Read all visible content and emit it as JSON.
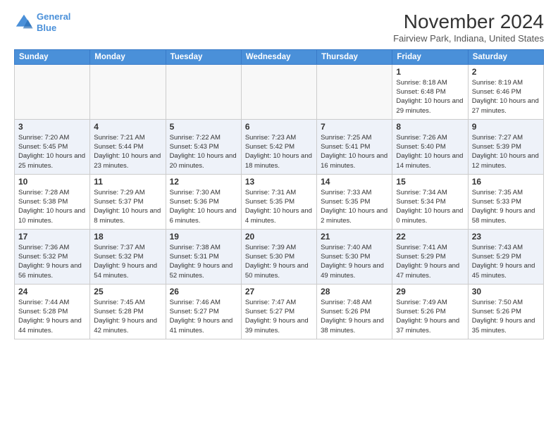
{
  "logo": {
    "line1": "General",
    "line2": "Blue"
  },
  "title": "November 2024",
  "location": "Fairview Park, Indiana, United States",
  "weekdays": [
    "Sunday",
    "Monday",
    "Tuesday",
    "Wednesday",
    "Thursday",
    "Friday",
    "Saturday"
  ],
  "weeks": [
    [
      {
        "day": "",
        "info": ""
      },
      {
        "day": "",
        "info": ""
      },
      {
        "day": "",
        "info": ""
      },
      {
        "day": "",
        "info": ""
      },
      {
        "day": "",
        "info": ""
      },
      {
        "day": "1",
        "info": "Sunrise: 8:18 AM\nSunset: 6:48 PM\nDaylight: 10 hours and 29 minutes."
      },
      {
        "day": "2",
        "info": "Sunrise: 8:19 AM\nSunset: 6:46 PM\nDaylight: 10 hours and 27 minutes."
      }
    ],
    [
      {
        "day": "3",
        "info": "Sunrise: 7:20 AM\nSunset: 5:45 PM\nDaylight: 10 hours and 25 minutes."
      },
      {
        "day": "4",
        "info": "Sunrise: 7:21 AM\nSunset: 5:44 PM\nDaylight: 10 hours and 23 minutes."
      },
      {
        "day": "5",
        "info": "Sunrise: 7:22 AM\nSunset: 5:43 PM\nDaylight: 10 hours and 20 minutes."
      },
      {
        "day": "6",
        "info": "Sunrise: 7:23 AM\nSunset: 5:42 PM\nDaylight: 10 hours and 18 minutes."
      },
      {
        "day": "7",
        "info": "Sunrise: 7:25 AM\nSunset: 5:41 PM\nDaylight: 10 hours and 16 minutes."
      },
      {
        "day": "8",
        "info": "Sunrise: 7:26 AM\nSunset: 5:40 PM\nDaylight: 10 hours and 14 minutes."
      },
      {
        "day": "9",
        "info": "Sunrise: 7:27 AM\nSunset: 5:39 PM\nDaylight: 10 hours and 12 minutes."
      }
    ],
    [
      {
        "day": "10",
        "info": "Sunrise: 7:28 AM\nSunset: 5:38 PM\nDaylight: 10 hours and 10 minutes."
      },
      {
        "day": "11",
        "info": "Sunrise: 7:29 AM\nSunset: 5:37 PM\nDaylight: 10 hours and 8 minutes."
      },
      {
        "day": "12",
        "info": "Sunrise: 7:30 AM\nSunset: 5:36 PM\nDaylight: 10 hours and 6 minutes."
      },
      {
        "day": "13",
        "info": "Sunrise: 7:31 AM\nSunset: 5:35 PM\nDaylight: 10 hours and 4 minutes."
      },
      {
        "day": "14",
        "info": "Sunrise: 7:33 AM\nSunset: 5:35 PM\nDaylight: 10 hours and 2 minutes."
      },
      {
        "day": "15",
        "info": "Sunrise: 7:34 AM\nSunset: 5:34 PM\nDaylight: 10 hours and 0 minutes."
      },
      {
        "day": "16",
        "info": "Sunrise: 7:35 AM\nSunset: 5:33 PM\nDaylight: 9 hours and 58 minutes."
      }
    ],
    [
      {
        "day": "17",
        "info": "Sunrise: 7:36 AM\nSunset: 5:32 PM\nDaylight: 9 hours and 56 minutes."
      },
      {
        "day": "18",
        "info": "Sunrise: 7:37 AM\nSunset: 5:32 PM\nDaylight: 9 hours and 54 minutes."
      },
      {
        "day": "19",
        "info": "Sunrise: 7:38 AM\nSunset: 5:31 PM\nDaylight: 9 hours and 52 minutes."
      },
      {
        "day": "20",
        "info": "Sunrise: 7:39 AM\nSunset: 5:30 PM\nDaylight: 9 hours and 50 minutes."
      },
      {
        "day": "21",
        "info": "Sunrise: 7:40 AM\nSunset: 5:30 PM\nDaylight: 9 hours and 49 minutes."
      },
      {
        "day": "22",
        "info": "Sunrise: 7:41 AM\nSunset: 5:29 PM\nDaylight: 9 hours and 47 minutes."
      },
      {
        "day": "23",
        "info": "Sunrise: 7:43 AM\nSunset: 5:29 PM\nDaylight: 9 hours and 45 minutes."
      }
    ],
    [
      {
        "day": "24",
        "info": "Sunrise: 7:44 AM\nSunset: 5:28 PM\nDaylight: 9 hours and 44 minutes."
      },
      {
        "day": "25",
        "info": "Sunrise: 7:45 AM\nSunset: 5:28 PM\nDaylight: 9 hours and 42 minutes."
      },
      {
        "day": "26",
        "info": "Sunrise: 7:46 AM\nSunset: 5:27 PM\nDaylight: 9 hours and 41 minutes."
      },
      {
        "day": "27",
        "info": "Sunrise: 7:47 AM\nSunset: 5:27 PM\nDaylight: 9 hours and 39 minutes."
      },
      {
        "day": "28",
        "info": "Sunrise: 7:48 AM\nSunset: 5:26 PM\nDaylight: 9 hours and 38 minutes."
      },
      {
        "day": "29",
        "info": "Sunrise: 7:49 AM\nSunset: 5:26 PM\nDaylight: 9 hours and 37 minutes."
      },
      {
        "day": "30",
        "info": "Sunrise: 7:50 AM\nSunset: 5:26 PM\nDaylight: 9 hours and 35 minutes."
      }
    ]
  ]
}
